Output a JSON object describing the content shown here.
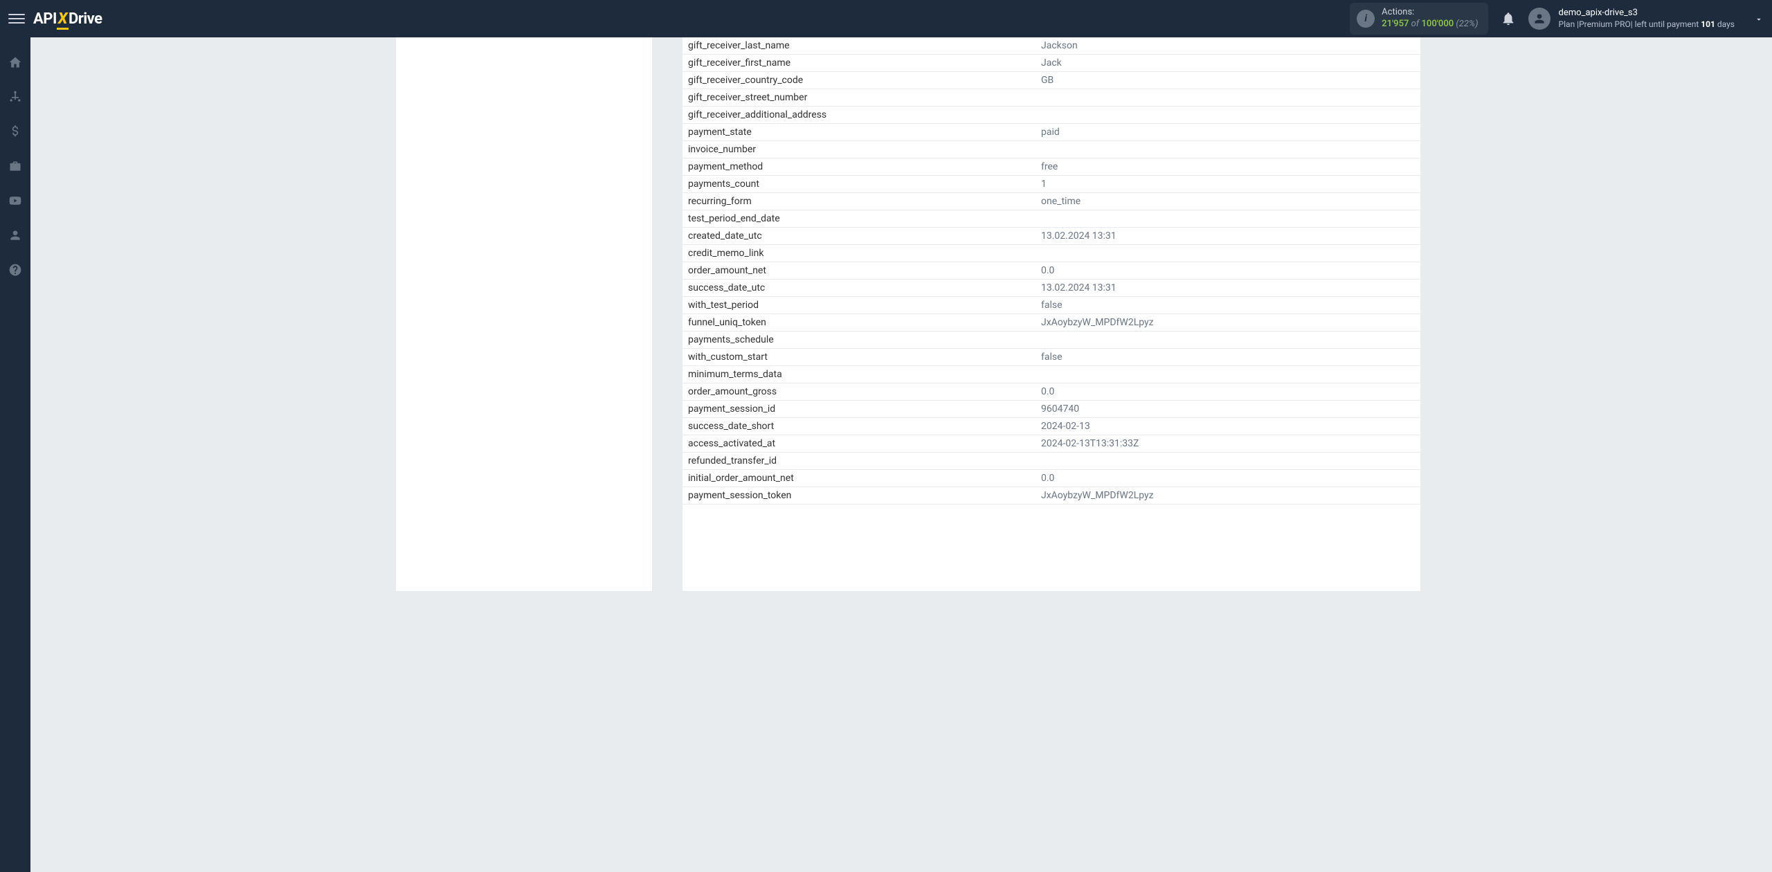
{
  "header": {
    "logo": {
      "api": "API",
      "x": "X",
      "drive": "Drive"
    },
    "actions": {
      "label": "Actions:",
      "count": "21'957",
      "of": "of",
      "total": "100'000",
      "pct": "(22%)"
    },
    "user": {
      "name": "demo_apix-drive_s3",
      "plan_prefix": "Plan |Premium PRO| left until payment ",
      "days_num": "101",
      "days_suffix": " days"
    }
  },
  "sidebar": {
    "items": [
      {
        "name": "home"
      },
      {
        "name": "connections"
      },
      {
        "name": "billing"
      },
      {
        "name": "briefcase"
      },
      {
        "name": "youtube"
      },
      {
        "name": "account"
      },
      {
        "name": "help"
      }
    ]
  },
  "fields": [
    {
      "key": "gift_receiver_last_name",
      "value": "Jackson"
    },
    {
      "key": "gift_receiver_first_name",
      "value": "Jack"
    },
    {
      "key": "gift_receiver_country_code",
      "value": "GB"
    },
    {
      "key": "gift_receiver_street_number",
      "value": ""
    },
    {
      "key": "gift_receiver_additional_address",
      "value": ""
    },
    {
      "key": "payment_state",
      "value": "paid"
    },
    {
      "key": "invoice_number",
      "value": ""
    },
    {
      "key": "payment_method",
      "value": "free"
    },
    {
      "key": "payments_count",
      "value": "1"
    },
    {
      "key": "recurring_form",
      "value": "one_time"
    },
    {
      "key": "test_period_end_date",
      "value": ""
    },
    {
      "key": "created_date_utc",
      "value": "13.02.2024 13:31"
    },
    {
      "key": "credit_memo_link",
      "value": ""
    },
    {
      "key": "order_amount_net",
      "value": "0.0"
    },
    {
      "key": "success_date_utc",
      "value": "13.02.2024 13:31"
    },
    {
      "key": "with_test_period",
      "value": "false"
    },
    {
      "key": "funnel_uniq_token",
      "value": "JxAoybzyW_MPDfW2Lpyz"
    },
    {
      "key": "payments_schedule",
      "value": ""
    },
    {
      "key": "with_custom_start",
      "value": "false"
    },
    {
      "key": "minimum_terms_data",
      "value": ""
    },
    {
      "key": "order_amount_gross",
      "value": "0.0"
    },
    {
      "key": "payment_session_id",
      "value": "9604740"
    },
    {
      "key": "success_date_short",
      "value": "2024-02-13"
    },
    {
      "key": "access_activated_at",
      "value": "2024-02-13T13:31:33Z"
    },
    {
      "key": "refunded_transfer_id",
      "value": ""
    },
    {
      "key": "initial_order_amount_net",
      "value": "0.0"
    },
    {
      "key": "payment_session_token",
      "value": "JxAoybzyW_MPDfW2Lpyz"
    }
  ]
}
